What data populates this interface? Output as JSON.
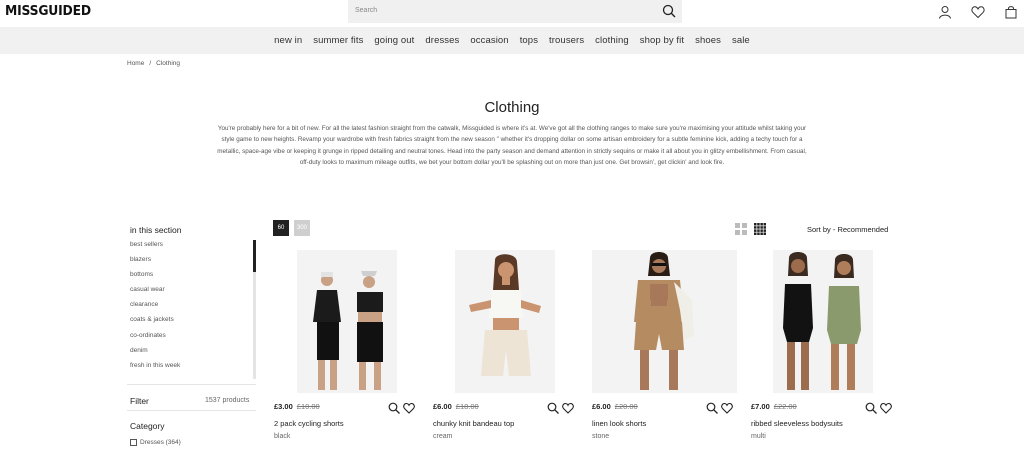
{
  "brand": {
    "logo": "MISSGUIDED"
  },
  "search": {
    "placeholder": "Search"
  },
  "nav": {
    "items": [
      "new in",
      "summer fits",
      "going out",
      "dresses",
      "occasion",
      "tops",
      "trousers",
      "clothing",
      "shop by fit",
      "shoes",
      "sale"
    ]
  },
  "breadcrumb": {
    "home": "Home",
    "separator": "/",
    "current": "Clothing"
  },
  "page": {
    "title": "Clothing",
    "intro": "You're probably here for a bit of new. For all the latest fashion straight from the catwalk, Missguided is where it's at. We've got all the clothing ranges to make sure you're maximising your attitude whilst taking your style game to new heights. Revamp your wardrobe with fresh fabrics straight from the new season \" whether it's dropping dollar on some artisan embroidery for a subtle feminine kick, adding a techy touch for a metallic, space-age vibe or keeping it grunge in ripped detailing and neutral tones. Head into the party season and demand attention in strictly sequins or make it all about you in glitzy embellishment. From casual, off-duty looks to maximum mileage outfits, we bet your bottom dollar you'll be splashing out on more than just one. Get browsin', get clickin' and look fire."
  },
  "sidebar": {
    "heading": "in this section",
    "items": [
      "best sellers",
      "blazers",
      "bottoms",
      "casual wear",
      "clearance",
      "coats & jackets",
      "co-ordinates",
      "denim",
      "fresh in this week"
    ],
    "filter_label": "Filter",
    "product_count": "1537 products",
    "category_label": "Category",
    "category_first": "Dresses (364)"
  },
  "toolbar": {
    "per_page": [
      "60",
      "300"
    ],
    "sort_prefix": "Sort by",
    "sort_value": "- Recommended"
  },
  "products": [
    {
      "price": "£3.00",
      "was": "£10.00",
      "name": "2 pack cycling shorts",
      "color": "black"
    },
    {
      "price": "£6.00",
      "was": "£18.00",
      "name": "chunky knit bandeau top",
      "color": "cream"
    },
    {
      "price": "£6.00",
      "was": "£20.00",
      "name": "linen look shorts",
      "color": "stone"
    },
    {
      "price": "£7.00",
      "was": "£22.00",
      "name": "ribbed sleeveless bodysuits",
      "color": "multi"
    }
  ],
  "colors": {
    "nav_bg": "#f1f1f1",
    "search_bg": "#f0f0f0",
    "text": "#222222",
    "muted": "#555555"
  }
}
